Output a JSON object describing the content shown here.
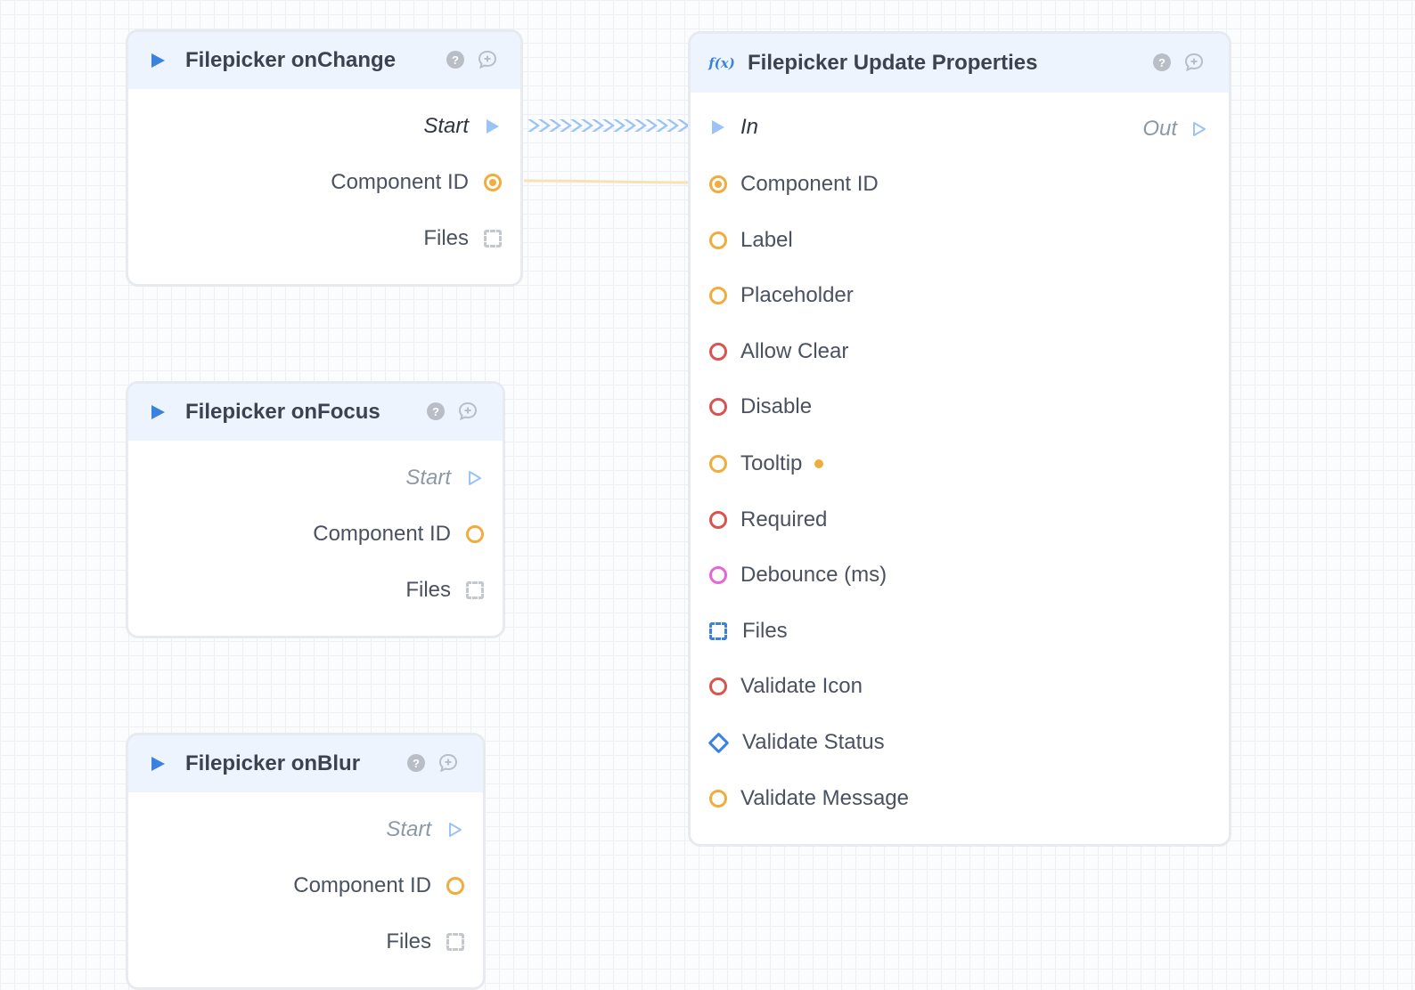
{
  "colors": {
    "exec_blue": "#3b82e0",
    "exec_light": "#9cc3f5",
    "string_orange": "#f0ad3e",
    "boolean_red": "#d9534f",
    "number_magenta": "#e466d8",
    "array_grey": "#c3c8cf",
    "header_bg": "#eef4fd"
  },
  "nodes": {
    "on_change": {
      "title": "Filepicker onChange",
      "icon": "play-icon",
      "outputs": {
        "start": "Start",
        "component_id": "Component ID",
        "files": "Files"
      }
    },
    "on_focus": {
      "title": "Filepicker onFocus",
      "icon": "play-icon",
      "outputs": {
        "start": "Start",
        "component_id": "Component ID",
        "files": "Files"
      }
    },
    "on_blur": {
      "title": "Filepicker onBlur",
      "icon": "play-icon",
      "outputs": {
        "start": "Start",
        "component_id": "Component ID",
        "files": "Files"
      }
    },
    "update_props": {
      "title": "Filepicker Update Properties",
      "icon": "function-icon",
      "icon_text": "f(x)",
      "exec_in": "In",
      "exec_out": "Out",
      "inputs": {
        "component_id": "Component ID",
        "label": "Label",
        "placeholder": "Placeholder",
        "allow_clear": "Allow Clear",
        "disable": "Disable",
        "tooltip": "Tooltip",
        "required": "Required",
        "debounce": "Debounce (ms)",
        "files": "Files",
        "validate_icon": "Validate Icon",
        "validate_status": "Validate Status",
        "validate_message": "Validate Message"
      }
    }
  },
  "header_buttons": {
    "help": "?",
    "help_icon": "help-icon",
    "comment_icon": "comment-add-icon"
  }
}
